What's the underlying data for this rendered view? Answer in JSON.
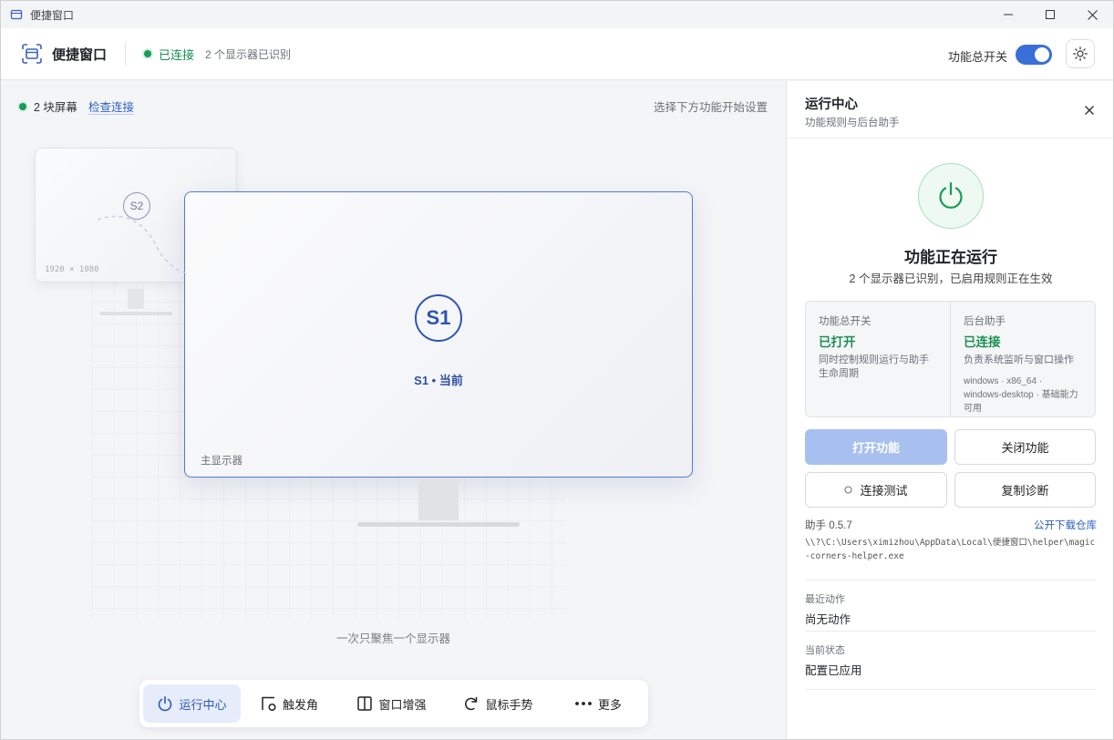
{
  "titlebar": {
    "title": "便捷窗口"
  },
  "header": {
    "brand": "便捷窗口",
    "connection_status": "已连接",
    "monitors_detected": "2 个显示器已识别",
    "master_switch_label": "功能总开关",
    "master_switch_on": true,
    "accent_color": "#3b6fd8",
    "success_color": "#1a9b58"
  },
  "main": {
    "screens_count": "2 块屏幕",
    "check_connection": "检查连接",
    "hint": "选择下方功能开始设置",
    "monitor_secondary": {
      "badge": "S2",
      "resolution": "1920 × 1080"
    },
    "monitor_primary": {
      "badge": "S1",
      "caption": "S1 • 当前",
      "label": "主显示器"
    },
    "focus_hint": "一次只聚焦一个显示器",
    "nav": [
      {
        "label": "运行中心",
        "icon": "power-icon",
        "active": true
      },
      {
        "label": "触发角",
        "icon": "corner-icon",
        "active": false
      },
      {
        "label": "窗口增强",
        "icon": "window-split-icon",
        "active": false
      },
      {
        "label": "鼠标手势",
        "icon": "gesture-icon",
        "active": false
      },
      {
        "label": "更多",
        "icon": "more-dots-icon",
        "active": false
      }
    ]
  },
  "panel": {
    "title": "运行中心",
    "subtitle": "功能规则与后台助手",
    "run_title": "功能正在运行",
    "run_subtitle": "2 个显示器已识别，已启用规则正在生效",
    "master": {
      "label": "功能总开关",
      "value": "已打开",
      "desc": "同时控制规则运行与助手生命周期"
    },
    "helper": {
      "label": "后台助手",
      "value": "已连接",
      "desc": "负责系统监听与窗口操作",
      "meta": "windows · x86_64 · windows-desktop · 基础能力可用"
    },
    "buttons": {
      "open": "打开功能",
      "close": "关闭功能",
      "test": "连接测试",
      "copy": "复制诊断"
    },
    "helper_version": "助手 0.5.7",
    "download_link": "公开下载仓库",
    "helper_path": "\\\\?\\C:\\Users\\ximizhou\\AppData\\Local\\便捷窗口\\helper\\magic-corners-helper.exe",
    "recent_action_label": "最近动作",
    "recent_action_value": "尚无动作",
    "current_status_label": "当前状态",
    "current_status_value": "配置已应用"
  }
}
